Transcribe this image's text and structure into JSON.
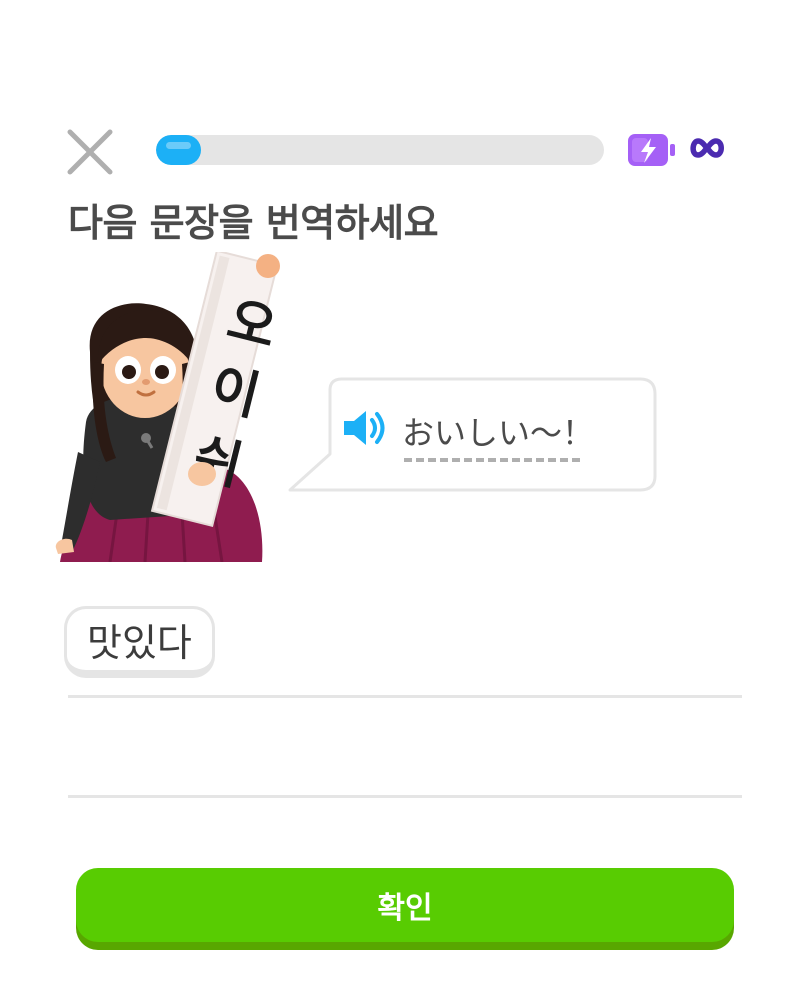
{
  "header": {
    "close_icon": "close-icon",
    "progress_fraction": 0.1,
    "progress_color": "#1cb0f6",
    "energy_icon": "energy-battery-icon",
    "energy_value": "∞",
    "energy_color": "#a560f6",
    "infinity_color": "#4b2bb0"
  },
  "prompt": {
    "title": "다음 문장을 번역하세요",
    "character_sign": "오이쉬"
  },
  "bubble": {
    "speaker_icon": "speaker-icon",
    "text": "おいしい〜！"
  },
  "answer": {
    "selected_words": [
      "맛있다"
    ]
  },
  "footer": {
    "check_label": "확인",
    "check_color": "#58cc02"
  }
}
